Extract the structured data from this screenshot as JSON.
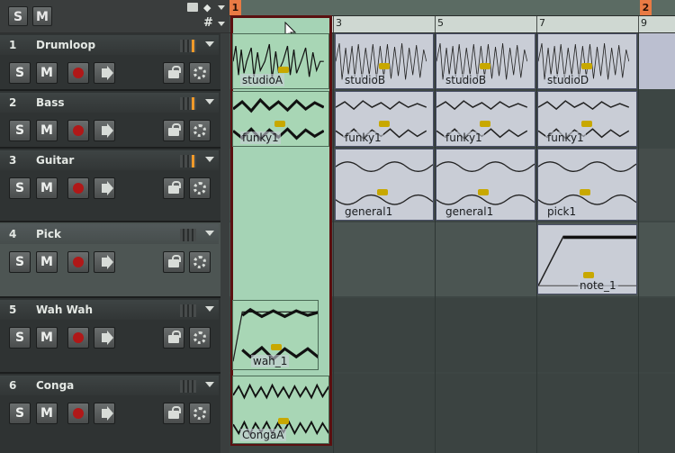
{
  "header": {
    "solo_label": "S",
    "mute_label": "M"
  },
  "ruler": {
    "markers": [
      "1",
      "2"
    ],
    "bars": [
      "1",
      "3",
      "5",
      "7",
      "9"
    ]
  },
  "controls": {
    "solo": "S",
    "mute": "M"
  },
  "tracks": [
    {
      "number": "1",
      "name": "Drumloop",
      "meter_active": true
    },
    {
      "number": "2",
      "name": "Bass",
      "meter_active": true
    },
    {
      "number": "3",
      "name": "Guitar",
      "meter_active": true
    },
    {
      "number": "4",
      "name": "Pick",
      "meter_active": false
    },
    {
      "number": "5",
      "name": "Wah Wah",
      "meter_active": false
    },
    {
      "number": "6",
      "name": "Conga",
      "meter_active": false
    }
  ],
  "clips": {
    "drumloop": [
      "studioA",
      "studioB",
      "studioB",
      "studioD"
    ],
    "bass": [
      "funky1",
      "funky1",
      "funky1",
      "funky1"
    ],
    "guitar": [
      "general1",
      "general1",
      "pick1"
    ],
    "pick": [
      "note_1"
    ],
    "wahwah": [
      "wah_1"
    ],
    "conga": [
      "CongaA"
    ]
  },
  "colors": {
    "selection": "#a5d3b5",
    "clip": "#c9cdd6",
    "marker": "#e87a44",
    "record": "#b01818"
  }
}
